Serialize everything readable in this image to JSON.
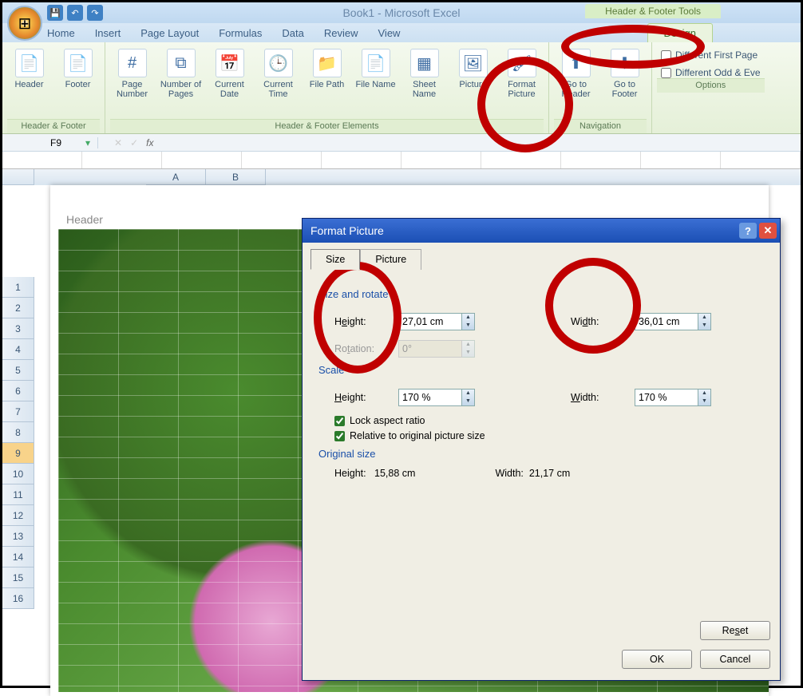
{
  "titlebar": {
    "title": "Book1 - Microsoft Excel",
    "context_title": "Header & Footer Tools"
  },
  "tabs": {
    "items": [
      "Home",
      "Insert",
      "Page Layout",
      "Formulas",
      "Data",
      "Review",
      "View"
    ],
    "context": "Design"
  },
  "ribbon": {
    "group1": {
      "label": "Header & Footer",
      "btns": [
        {
          "l": "Header"
        },
        {
          "l": "Footer"
        }
      ]
    },
    "group2": {
      "label": "Header & Footer Elements",
      "btns": [
        {
          "l": "Page Number"
        },
        {
          "l": "Number of Pages"
        },
        {
          "l": "Current Date"
        },
        {
          "l": "Current Time"
        },
        {
          "l": "File Path"
        },
        {
          "l": "File Name"
        },
        {
          "l": "Sheet Name"
        },
        {
          "l": "Picture"
        },
        {
          "l": "Format Picture"
        }
      ]
    },
    "group3": {
      "label": "Navigation",
      "btns": [
        {
          "l": "Go to Header"
        },
        {
          "l": "Go to Footer"
        }
      ]
    },
    "group4": {
      "label": "Options",
      "chk1": "Different First Page",
      "chk2": "Different Odd & Eve"
    }
  },
  "namebox": {
    "cell": "F9",
    "fx": "fx"
  },
  "columns": [
    "A",
    "B"
  ],
  "rows": [
    "1",
    "2",
    "3",
    "4",
    "5",
    "6",
    "7",
    "8",
    "9",
    "10",
    "11",
    "12",
    "13",
    "14",
    "15",
    "16"
  ],
  "selected_row": "9",
  "header_label": "Header",
  "dialog": {
    "title": "Format Picture",
    "tabs": {
      "t1": "Size",
      "t2": "Picture"
    },
    "sec_size": "Size and rotate",
    "height_lbl": "Height:",
    "height_val": "27,01 cm",
    "width_lbl": "Width:",
    "width_val": "36,01 cm",
    "rotation_lbl": "Rotation:",
    "rotation_val": "0°",
    "sec_scale": "Scale",
    "sheight_lbl": "Height:",
    "sheight_val": "170 %",
    "swidth_lbl": "Width:",
    "swidth_val": "170 %",
    "lock": "Lock aspect ratio",
    "relative": "Relative to original picture size",
    "sec_orig": "Original size",
    "oheight_lbl": "Height:",
    "oheight_val": "15,88 cm",
    "owidth_lbl": "Width:",
    "owidth_val": "21,17 cm",
    "reset": "Reset",
    "ok": "OK",
    "cancel": "Cancel"
  }
}
